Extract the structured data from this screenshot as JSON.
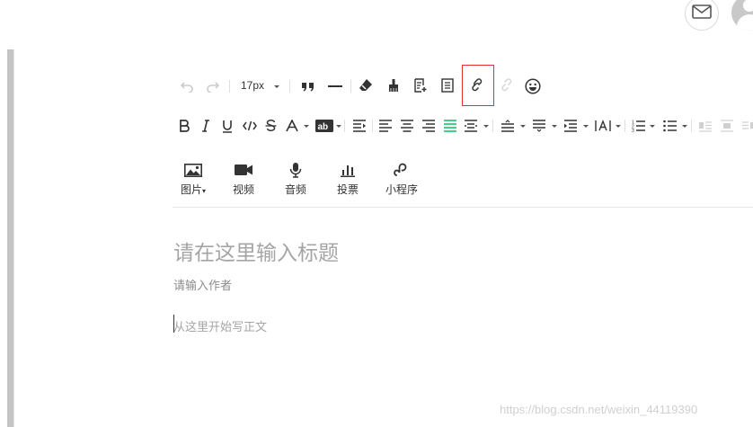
{
  "header": {
    "mail_icon": "mail-icon",
    "avatar_icon": "user-avatar-icon"
  },
  "toolbar_row1": {
    "font_size": "17px",
    "icons": [
      "undo-icon",
      "redo-icon",
      "blockquote-icon",
      "horizontal-rule-icon",
      "clear-format-icon",
      "format-painter-icon",
      "insert-template-icon",
      "page-icon",
      "link-icon",
      "unlink-icon",
      "emoji-icon"
    ]
  },
  "toolbar_row2": {
    "icons": [
      "bold-icon",
      "italic-icon",
      "underline-icon",
      "code-icon",
      "strikethrough-icon",
      "font-color-icon",
      "background-color-icon",
      "indent-icon",
      "align-left-icon",
      "align-center-icon",
      "align-right-icon",
      "align-justify-icon",
      "align-distribute-icon",
      "line-height-icon",
      "paragraph-spacing-icon",
      "indent-more-icon",
      "letter-spacing-icon",
      "ordered-list-icon",
      "unordered-list-icon",
      "float-left-icon",
      "float-none-icon",
      "float-right-icon"
    ],
    "active_color": "#07c160"
  },
  "media": {
    "image_label": "图片",
    "video_label": "视频",
    "audio_label": "音频",
    "vote_label": "投票",
    "miniprogram_label": "小程序"
  },
  "editor": {
    "title_placeholder": "请在这里输入标题",
    "author_placeholder": "请输入作者",
    "body_placeholder": "从这里开始写正文"
  },
  "watermark": "https://blog.csdn.net/weixin_44119390",
  "colors": {
    "highlight_border": "#e03030",
    "placeholder": "#a5a5a5"
  }
}
